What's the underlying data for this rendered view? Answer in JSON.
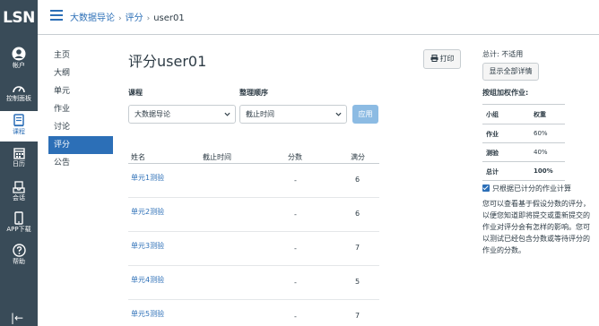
{
  "global_nav": {
    "logo": "LSN",
    "items": [
      {
        "label": "帐户",
        "icon": "account-icon"
      },
      {
        "label": "控制面板",
        "icon": "dashboard-icon"
      },
      {
        "label": "课程",
        "icon": "courses-icon",
        "active": true
      },
      {
        "label": "日历",
        "icon": "calendar-icon"
      },
      {
        "label": "会话",
        "icon": "inbox-icon"
      },
      {
        "label": "APP下载",
        "icon": "phone-icon"
      },
      {
        "label": "帮助",
        "icon": "help-icon"
      }
    ],
    "collapse_glyph": "|←"
  },
  "breadcrumb": {
    "course": "大数据导论",
    "section": "评分",
    "current": "user01",
    "separator": "›"
  },
  "course_nav": [
    "主页",
    "大纲",
    "单元",
    "作业",
    "讨论",
    "评分",
    "公告"
  ],
  "course_nav_active": "评分",
  "page_title": "评分user01",
  "print_label": "打印",
  "filters": {
    "course_label": "课程",
    "course_value": "大数据导论",
    "sort_label": "整理顺序",
    "sort_value": "截止时间",
    "apply_label": "应用"
  },
  "table": {
    "headers": [
      "姓名",
      "截止时间",
      "分数",
      "满分"
    ],
    "rows": [
      {
        "name": "单元1测验",
        "due": "",
        "score": "-",
        "max": "6"
      },
      {
        "name": "单元2测验",
        "due": "",
        "score": "-",
        "max": "6"
      },
      {
        "name": "单元3测验",
        "due": "",
        "score": "-",
        "max": "7"
      },
      {
        "name": "单元4测验",
        "due": "",
        "score": "-",
        "max": "5"
      },
      {
        "name": "单元5测验",
        "due": "",
        "score": "-",
        "max": "7"
      }
    ]
  },
  "sidebar": {
    "total": "总计: 不适用",
    "show_all_button": "显示全部详情",
    "weights_heading": "按组加权作业:",
    "weights_headers": [
      "小组",
      "权重"
    ],
    "weights_rows": [
      {
        "group": "作业",
        "weight": "60%"
      },
      {
        "group": "测验",
        "weight": "40%"
      },
      {
        "group": "总计",
        "weight": "100%"
      }
    ],
    "checkbox_label": "只根据已计分的作业计算",
    "note": "您可以查看基于假设分数的评分，以便您知道即将提交或重新提交的作业对评分会有怎样的影响。您可以测试已经包含分数或等待评分的作业的分数。"
  },
  "colors": {
    "nav_bg": "#394b58",
    "accent": "#2c6fb7",
    "apply_disabled": "#8cbbe3"
  }
}
